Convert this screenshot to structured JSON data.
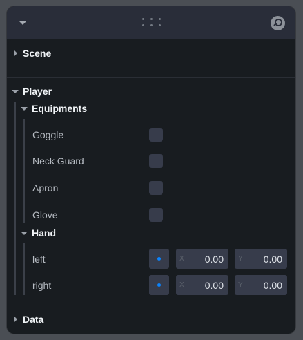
{
  "folders": {
    "scene": {
      "title": "Scene"
    },
    "player": {
      "title": "Player"
    },
    "data": {
      "title": "Data"
    }
  },
  "equipments": {
    "title": "Equipments",
    "items": [
      {
        "label": "Goggle",
        "checked": false
      },
      {
        "label": "Neck Guard",
        "checked": false
      },
      {
        "label": "Apron",
        "checked": false
      },
      {
        "label": "Glove",
        "checked": false
      }
    ]
  },
  "hand": {
    "title": "Hand",
    "rows": [
      {
        "label": "left",
        "x_axis": "X",
        "x": "0.00",
        "y_axis": "Y",
        "y": "0.00"
      },
      {
        "label": "right",
        "x_axis": "X",
        "x": "0.00",
        "y_axis": "Y",
        "y": "0.00"
      }
    ]
  },
  "colors": {
    "panel_bg": "#181c20",
    "titlebar_bg": "#292d39",
    "field_bg": "#373c4b",
    "accent": "#0a84ff"
  },
  "icons": {
    "collapse": "caret-down-icon",
    "drag": "drag-dots-icon",
    "search": "search-icon"
  }
}
